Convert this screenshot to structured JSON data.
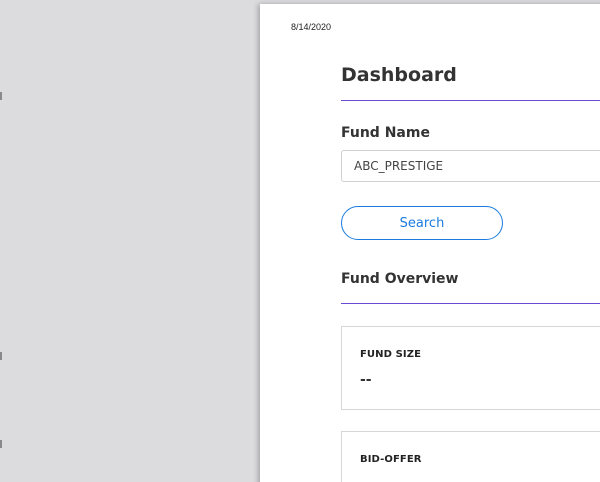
{
  "print_date": "8/14/2020",
  "dashboard": {
    "title": "Dashboard"
  },
  "fund_search": {
    "label": "Fund Name",
    "input_value": "ABC_PRESTIGE",
    "search_label": "Search"
  },
  "overview": {
    "title": "Fund Overview",
    "cards": [
      {
        "label": "FUND SIZE",
        "value": "--"
      },
      {
        "label": "BID-OFFER",
        "value": ""
      }
    ]
  },
  "colors": {
    "accent_rule": "#6a4bd6",
    "button_blue": "#1a7be0",
    "viewer_background": "#dcdcdf"
  }
}
